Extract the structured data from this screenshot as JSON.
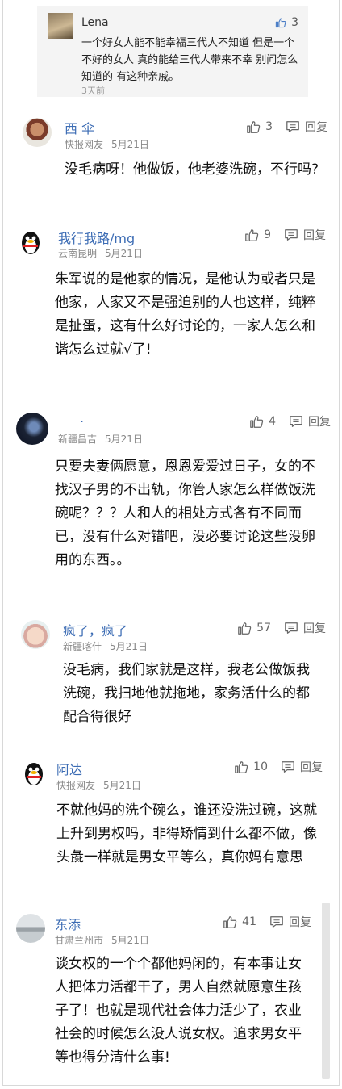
{
  "reply": {
    "name": "Lena",
    "likes": "3",
    "text": "一个好女人能不能幸福三代人不知道 但是一个不好的女人 真的能给三代人带来不幸 别问怎么知道的 有这种亲戚。",
    "time": "3天前"
  },
  "reply_label": "回复",
  "comments": [
    {
      "name": "西 伞",
      "location": "快报网友",
      "date": "5月21日",
      "likes": "3",
      "body": "没毛病呀！他做饭，他老婆洗碗，不行吗?"
    },
    {
      "name": "我行我路/mg",
      "location": "云南昆明",
      "date": "5月21日",
      "likes": "9",
      "body": "朱军说的是他家的情况，是他认为或者只是他家，人家又不是强迫别的人也这样，纯粹是扯蛋，这有什么好讨论的，一家人怎么和谐怎么过就√了!"
    },
    {
      "name": ".",
      "location": "新疆昌吉",
      "date": "5月21日",
      "likes": "4",
      "body": "只要夫妻俩愿意，恩恩爱爱过日子，女的不找汉子男的不出轨，你管人家怎么样做饭洗碗呢？？？人和人的相处方式各有不同而已，没有什么对错吧，没必要讨论这些没卵用的东西。。"
    },
    {
      "name": "疯了，疯了",
      "location": "新疆喀什",
      "date": "5月21日",
      "likes": "57",
      "body": "没毛病，我们家就是这样，我老公做饭我洗碗，我扫地他就拖地，家务活什么的都配合得很好"
    },
    {
      "name": "阿达",
      "location": "快报网友",
      "date": "5月21日",
      "likes": "10",
      "body": "不就他妈的洗个碗么，谁还没洗过碗，这就上升到男权吗，非得矫情到什么都不做，像头彘一样就是男女平等么，真你妈有意思"
    },
    {
      "name": "东添",
      "location": "甘肃兰州市",
      "date": "5月21日",
      "likes": "41",
      "body": "谈女权的一个个都他妈闲的，有本事让女人把体力活都干了，男人自然就愿意生孩子了！也就是现代社会体力活少了，农业社会的时候怎么没人说女权。追求男女平等也得分清什么事!"
    }
  ]
}
